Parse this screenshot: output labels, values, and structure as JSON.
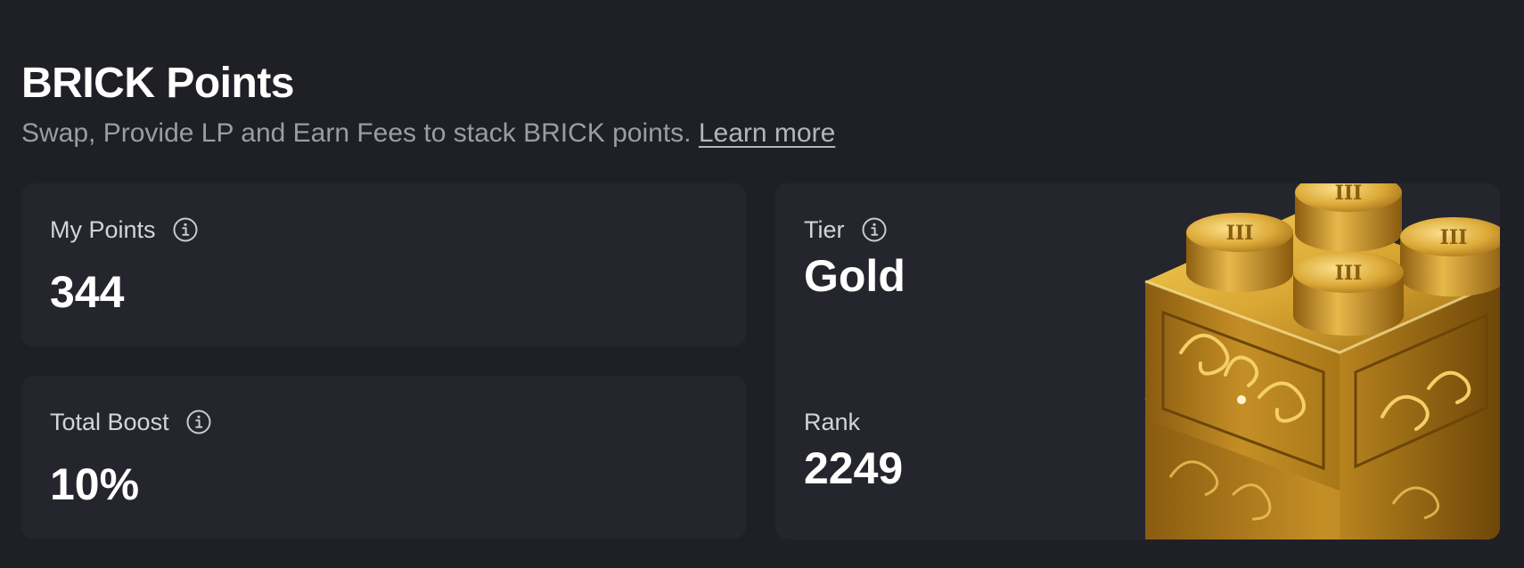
{
  "header": {
    "title": "BRICK Points",
    "subtitle": "Swap, Provide LP and Earn Fees to stack BRICK points.",
    "learn_more": "Learn more"
  },
  "stats": {
    "my_points": {
      "label": "My Points",
      "value": "344",
      "icon": "info-icon"
    },
    "total_boost": {
      "label": "Total Boost",
      "value": "10%",
      "icon": "info-icon"
    },
    "tier": {
      "label": "Tier",
      "value": "Gold",
      "icon": "info-icon"
    },
    "rank": {
      "label": "Rank",
      "value": "2249"
    }
  },
  "art": {
    "name": "gold-brick-image",
    "stud_marks": [
      "III",
      "III",
      "III",
      "III"
    ]
  },
  "colors": {
    "background": "#1f2026",
    "card": "#25262d",
    "text_primary": "#ffffff",
    "text_secondary": "#9a9ca6",
    "gold": "#c9952a"
  }
}
